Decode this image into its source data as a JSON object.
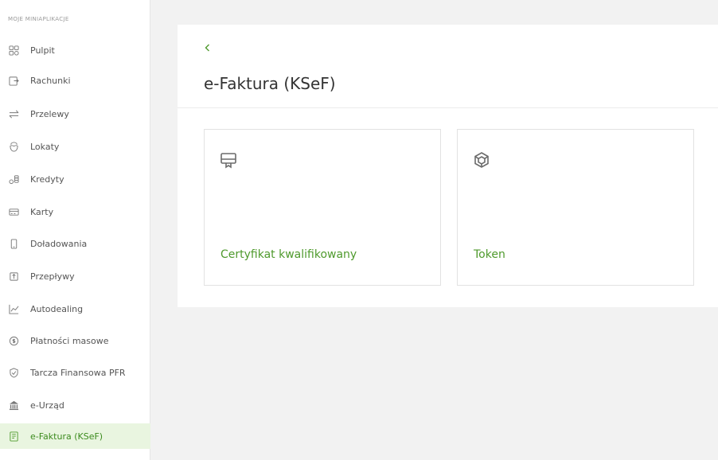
{
  "sidebar": {
    "header": "MOJE MINIAPLIKACJE",
    "items": [
      {
        "label": "Pulpit",
        "icon": "dashboard-icon"
      },
      {
        "label": "Rachunki",
        "icon": "accounts-icon"
      },
      {
        "label": "Przelewy",
        "icon": "transfer-arrows-icon"
      },
      {
        "label": "Lokaty",
        "icon": "deposits-icon"
      },
      {
        "label": "Kredyty",
        "icon": "credits-icon"
      },
      {
        "label": "Karty",
        "icon": "card-icon"
      },
      {
        "label": "Doładowania",
        "icon": "phone-icon"
      },
      {
        "label": "Przepływy",
        "icon": "cashflow-icon"
      },
      {
        "label": "Autodealing",
        "icon": "chart-line-icon"
      },
      {
        "label": "Płatności masowe",
        "icon": "bulk-payments-icon"
      },
      {
        "label": "Tarcza Finansowa PFR",
        "icon": "shield-icon"
      },
      {
        "label": "e-Urząd",
        "icon": "government-building-icon"
      },
      {
        "label": "e-Faktura (KSeF)",
        "icon": "invoice-icon",
        "active": true
      }
    ]
  },
  "main": {
    "back_icon": "chevron-left-icon",
    "title": "e-Faktura (KSeF)",
    "cards": [
      {
        "label": "Certyfikat kwalifikowany",
        "icon": "certificate-icon"
      },
      {
        "label": "Token",
        "icon": "token-cube-icon"
      }
    ]
  },
  "colors": {
    "accent": "#4f9a2d",
    "active_bg": "#e9f5e0",
    "page_bg": "#f2f2f2",
    "text": "#333333"
  }
}
